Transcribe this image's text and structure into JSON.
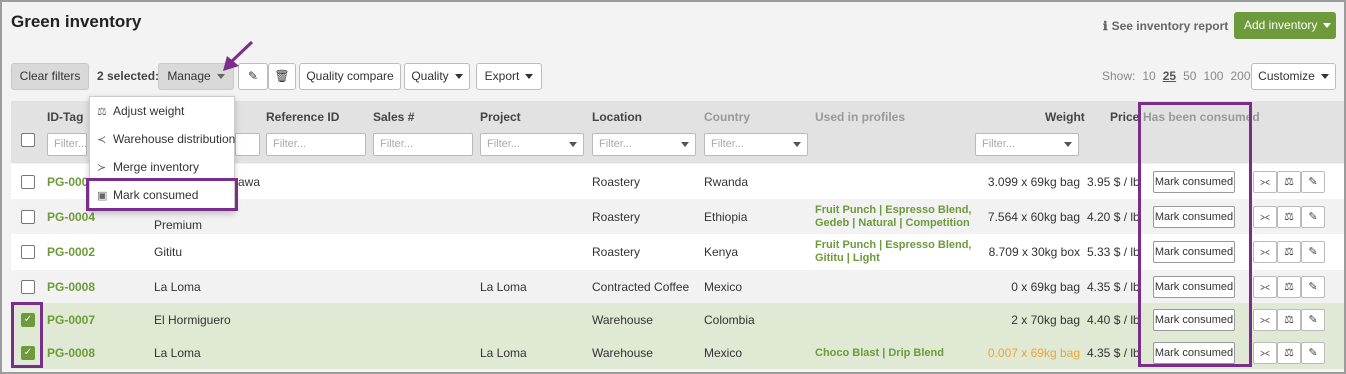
{
  "header": {
    "title": "Green inventory",
    "report_link": "See inventory report",
    "add_button": "Add inventory"
  },
  "toolbar": {
    "clear_filters": "Clear filters",
    "selected_label": "2 selected:",
    "manage": "Manage",
    "quality_compare": "Quality compare",
    "quality": "Quality",
    "export": "Export",
    "show_label": "Show:",
    "page_sizes": [
      "10",
      "25",
      "50",
      "100",
      "200"
    ],
    "active_page_size": "25",
    "customize": "Customize"
  },
  "manage_menu": {
    "items": [
      "Adjust weight",
      "Warehouse distribution",
      "Merge inventory",
      "Mark consumed"
    ]
  },
  "columns": {
    "id_tag": "ID-Tag",
    "reference_id": "Reference ID",
    "sales": "Sales #",
    "project": "Project",
    "location": "Location",
    "country": "Country",
    "used_in_profiles": "Used in profiles",
    "weight": "Weight",
    "price": "Price",
    "has_been_consumed": "Has been consumed"
  },
  "filter_placeholder": "Filter...",
  "rows": [
    {
      "id": "PG-000",
      "name": "awa",
      "name2": "",
      "project": "",
      "location": "Roastery",
      "country": "Rwanda",
      "profiles": "",
      "profiles2": "",
      "weight": "3.099 x 69kg bag",
      "price": "3.95 $ / lb",
      "checked": false,
      "weight_warn": false
    },
    {
      "id": "PG-0004",
      "name": "",
      "name2": "Premium",
      "project": "",
      "location": "Roastery",
      "country": "Ethiopia",
      "profiles": "Fruit Punch | Espresso Blend,",
      "profiles2": "Gedeb | Natural | Competition",
      "weight": "7.564 x 60kg bag",
      "price": "4.20 $ / lb",
      "checked": false,
      "weight_warn": false
    },
    {
      "id": "PG-0002",
      "name": "Gititu",
      "name2": "",
      "project": "",
      "location": "Roastery",
      "country": "Kenya",
      "profiles": "Fruit Punch | Espresso Blend,",
      "profiles2": "Gititu | Light",
      "weight": "8.709 x 30kg box",
      "price": "5.33 $ / lb",
      "checked": false,
      "weight_warn": false
    },
    {
      "id": "PG-0008",
      "name": "La Loma",
      "name2": "",
      "project": "La Loma",
      "location": "Contracted Coffee",
      "country": "Mexico",
      "profiles": "",
      "profiles2": "",
      "weight": "0 x 69kg bag",
      "price": "4.35 $ / lb",
      "checked": false,
      "weight_warn": false
    },
    {
      "id": "PG-0007",
      "name": "El Hormiguero",
      "name2": "",
      "project": "",
      "location": "Warehouse",
      "country": "Colombia",
      "profiles": "",
      "profiles2": "",
      "weight": "2 x 70kg bag",
      "price": "4.40 $ / lb",
      "checked": true,
      "weight_warn": false
    },
    {
      "id": "PG-0008",
      "name": "La Loma",
      "name2": "",
      "project": "La Loma",
      "location": "Warehouse",
      "country": "Mexico",
      "profiles": "Choco Blast | Drip Blend",
      "profiles2": "",
      "weight": "0.007 x 69kg bag",
      "price": "4.35 $ / lb",
      "checked": true,
      "weight_warn": true
    }
  ],
  "mark_consumed_label": "Mark consumed",
  "colors": {
    "accent_green": "#6d9a3a",
    "highlight_purple": "#7b2d8b",
    "warning_orange": "#e8a53a"
  }
}
